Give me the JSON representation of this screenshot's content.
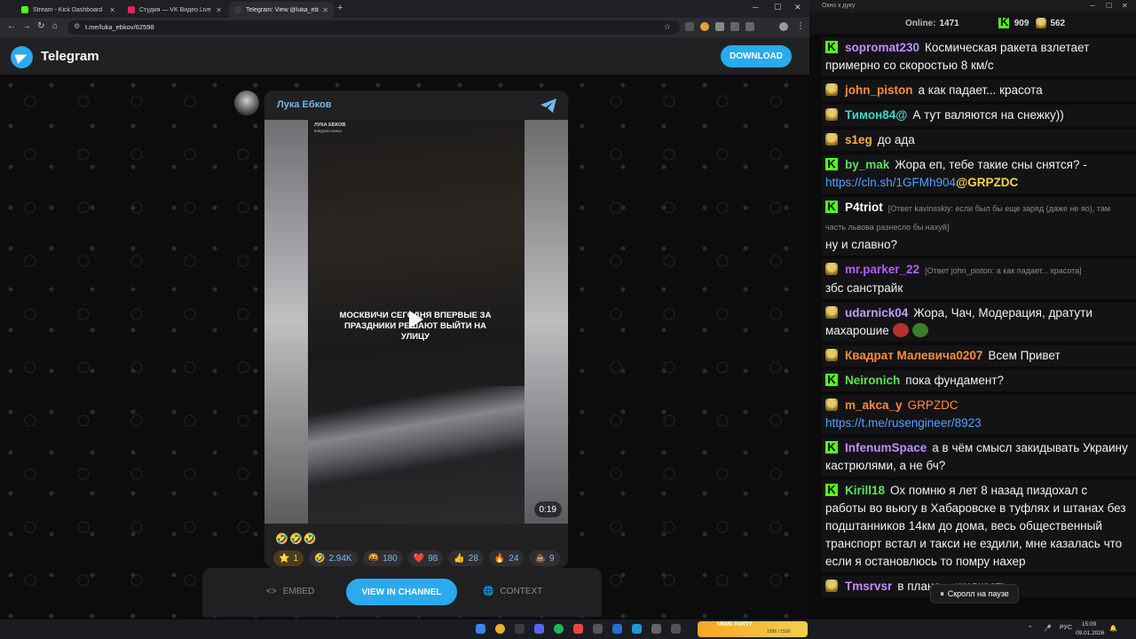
{
  "browser": {
    "tabs": [
      {
        "title": "Stream - Kick Dashboard",
        "color": "#53fc18"
      },
      {
        "title": "Студия — VK Видео Live",
        "color": "#e0245e"
      },
      {
        "title": "Telegram: View @luka_ebkov",
        "color": "#2aabee"
      }
    ],
    "url": "t.me/luka_ebkov/62598"
  },
  "telegram": {
    "brand": "Telegram",
    "download_label": "DOWNLOAD",
    "channel_name": "Лука Ебков",
    "video": {
      "watermark_title": "ЛУКА ЕБКОВ",
      "watermark_sub": "telegram-канал",
      "caption": "МОСКВИЧИ СЕГОДНЯ ВПЕРВЫЕ ЗА ПРАЗДНИКИ РЕШАЮТ ВЫЙТИ НА УЛИЦУ",
      "duration": "0:19"
    },
    "emoji_line": "🤣🤣🤣",
    "reactions": [
      {
        "icon": "⭐",
        "count": "1"
      },
      {
        "icon": "🤣",
        "count": "2.94K"
      },
      {
        "icon": "🤬",
        "count": "180"
      },
      {
        "icon": "❤️",
        "count": "98"
      },
      {
        "icon": "👍",
        "count": "28"
      },
      {
        "icon": "🔥",
        "count": "24"
      },
      {
        "icon": "💩",
        "count": "9"
      }
    ],
    "bottom": {
      "embed": "EMBED",
      "view_in_channel": "VIEW IN CHANNEL",
      "context": "CONTEXT"
    }
  },
  "chat": {
    "window_title": "Окно к дуку",
    "online_label": "Online:",
    "online_count": "1471",
    "kick_count": "909",
    "vk_count": "562",
    "paused_label": "Скролл на паузе",
    "messages": [
      {
        "badge": "kick",
        "user": "sopromat230",
        "color": "#c58cff",
        "reply": "",
        "text": "Космическая ракета взлетает примерно со скоростью 8 км/с"
      },
      {
        "badge": "cup",
        "user": "john_piston",
        "color": "#ff8a3d",
        "reply": "",
        "text": "а как падает... красота"
      },
      {
        "badge": "cup",
        "user": "Тимон84@",
        "color": "#3ed6c5",
        "reply": "",
        "text": "А тут валяются на снежку))"
      },
      {
        "badge": "cup",
        "user": "s1eg",
        "color": "#ffb03b",
        "reply": "",
        "text": "до ада"
      },
      {
        "badge": "kick",
        "user": "by_mak",
        "color": "#59e35b",
        "reply": "",
        "text": "Жора еп, тебе такие сны снятся? -",
        "link": "https://cln.sh/1GFMh904",
        "highlight": "@GRPZDC"
      },
      {
        "badge": "kick",
        "user": "P4triot",
        "color": "#ffffff",
        "reply": "[Ответ kavinsskiy: если был бы еще заряд (даже не яо), там часть львова разнесло бы нахуй]",
        "text": "ну и славно?"
      },
      {
        "badge": "cup",
        "user": "mr.parker_22",
        "color": "#b35cff",
        "reply": "[Ответ john_piston: а как падает... красота]",
        "text": "збс санстрайк"
      },
      {
        "badge": "cup",
        "user": "udarnick04",
        "color": "#c29bff",
        "reply": "",
        "text": "Жора, Чач, Модерация, дратути махарошие"
      },
      {
        "badge": "cup",
        "user": "Квадрат Малевича0207",
        "color": "#ff8a3d",
        "reply": "",
        "text": "Всем Привет"
      },
      {
        "badge": "kick",
        "user": "Neironich",
        "color": "#53e84a",
        "reply": "",
        "text": "пока фундамент?"
      },
      {
        "badge": "cup",
        "user": "m_akca_y",
        "color": "#ff8a3d",
        "reply": "",
        "text": "GRPZDC",
        "link": "https://t.me/rusengineer/8923"
      },
      {
        "badge": "kick",
        "user": "InfenumSpace",
        "color": "#c58cff",
        "reply": "",
        "text": "а в чём смысл закидывать Украину кастрюлями, а не бч?"
      },
      {
        "badge": "kick",
        "user": "Kirill18",
        "color": "#59e35b",
        "reply": "",
        "text": "Ох помню я лет 8 назад пиздохал с работы во вьюгу в Хабаровске в туфлях и штанах без подштанников 14км до дома, весь общественный транспорт встал и такси не ездили, мне казалась что если я остановлюсь то помру нахер"
      },
      {
        "badge": "cup",
        "user": "Tmsrvsr",
        "color": "#c58cff",
        "reply": "",
        "text": "в плане… жидкость"
      }
    ]
  },
  "taskbar": {
    "meme_title": "МЕМЕ PARTY",
    "meme_progress": "1306 / 1500",
    "lang": "РУС",
    "time": "15:09",
    "date": "09.01.2026"
  }
}
